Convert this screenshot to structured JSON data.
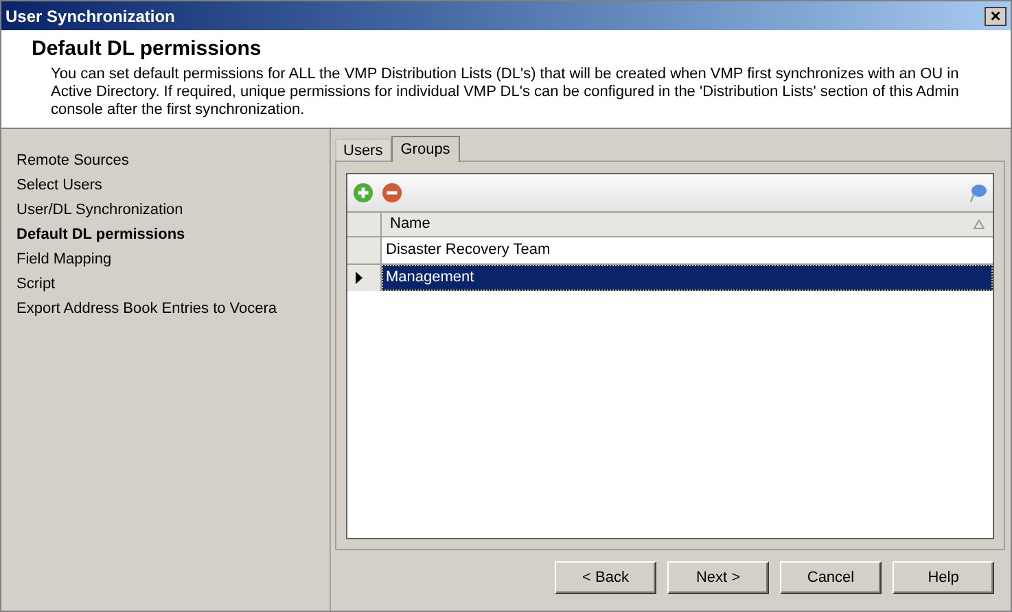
{
  "window": {
    "title": "User Synchronization",
    "close": "×"
  },
  "header": {
    "title": "Default DL permissions",
    "description": "You can set default permissions for ALL the VMP Distribution Lists (DL's) that will be created when VMP first synchronizes with an OU in Active Directory.  If required, unique permissions for individual VMP DL's can be configured in the 'Distribution Lists' section of this Admin console after the first synchronization."
  },
  "sidebar": {
    "items": [
      {
        "label": "Remote Sources",
        "selected": false
      },
      {
        "label": "Select Users",
        "selected": false
      },
      {
        "label": "User/DL Synchronization",
        "selected": false
      },
      {
        "label": "Default DL permissions",
        "selected": true
      },
      {
        "label": "Field Mapping",
        "selected": false
      },
      {
        "label": "Script",
        "selected": false
      },
      {
        "label": "Export Address Book Entries to Vocera",
        "selected": false
      }
    ]
  },
  "tabs": [
    {
      "label": "Users",
      "selected": false
    },
    {
      "label": "Groups",
      "selected": true
    }
  ],
  "table": {
    "columns": [
      "Name"
    ],
    "rows": [
      {
        "name": "Disaster Recovery Team",
        "selected": false
      },
      {
        "name": "Management",
        "selected": true
      }
    ]
  },
  "buttons": [
    "< Back",
    "Next >",
    "Cancel",
    "Help"
  ]
}
